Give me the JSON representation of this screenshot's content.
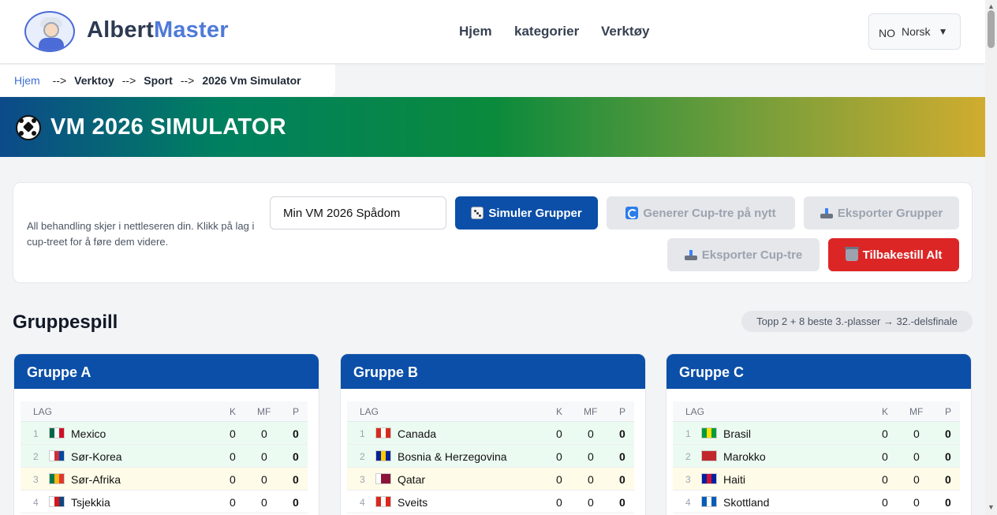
{
  "header": {
    "logo_part1": "Albert",
    "logo_part2": "Master",
    "nav": [
      "Hjem",
      "kategorier",
      "Verktøy"
    ],
    "language": {
      "code": "NO",
      "label": "Norsk",
      "caret": "▼"
    }
  },
  "breadcrumb": {
    "separator": "-->",
    "items": [
      "Hjem",
      "Verktoy",
      "Sport",
      "2026 Vm Simulator"
    ]
  },
  "banner": {
    "title": "VM 2026 SIMULATOR"
  },
  "controls": {
    "info": "All behandling skjer i nettleseren din. Klikk på lag i cup-treet for å føre dem videre.",
    "name_value": "Min VM 2026 Spådom",
    "buttons": {
      "simulate": "Simuler Grupper",
      "regenerate": "Generer Cup-tre på nytt",
      "export_groups": "Eksporter Grupper",
      "export_cup": "Eksporter Cup-tre",
      "reset": "Tilbakestill Alt"
    }
  },
  "groupstage": {
    "title": "Gruppespill",
    "note": "Topp 2 + 8 beste 3.-plasser → 32.-delsfinale",
    "columns": {
      "team": "LAG",
      "k": "K",
      "mf": "MF",
      "p": "P"
    },
    "groups": [
      {
        "name": "Gruppe A",
        "teams": [
          {
            "rank": "1",
            "name": "Mexico",
            "k": "0",
            "mf": "0",
            "p": "0",
            "flag": [
              "#006847",
              "#ffffff",
              "#ce1126"
            ]
          },
          {
            "rank": "2",
            "name": "Sør-Korea",
            "k": "0",
            "mf": "0",
            "p": "0",
            "flag": [
              "#ffffff",
              "#cd2e3a",
              "#0047a0"
            ]
          },
          {
            "rank": "3",
            "name": "Sør-Afrika",
            "k": "0",
            "mf": "0",
            "p": "0",
            "flag": [
              "#007a4d",
              "#ffb612",
              "#de3831"
            ]
          },
          {
            "rank": "4",
            "name": "Tsjekkia",
            "k": "0",
            "mf": "0",
            "p": "0",
            "flag": [
              "#ffffff",
              "#d7141a",
              "#11457e"
            ]
          }
        ]
      },
      {
        "name": "Gruppe B",
        "teams": [
          {
            "rank": "1",
            "name": "Canada",
            "k": "0",
            "mf": "0",
            "p": "0",
            "flag": [
              "#d52b1e",
              "#ffffff",
              "#d52b1e"
            ]
          },
          {
            "rank": "2",
            "name": "Bosnia & Herzegovina",
            "k": "0",
            "mf": "0",
            "p": "0",
            "flag": [
              "#002395",
              "#fecb00",
              "#002395"
            ]
          },
          {
            "rank": "3",
            "name": "Qatar",
            "k": "0",
            "mf": "0",
            "p": "0",
            "flag": [
              "#ffffff",
              "#8a1538",
              "#8a1538"
            ]
          },
          {
            "rank": "4",
            "name": "Sveits",
            "k": "0",
            "mf": "0",
            "p": "0",
            "flag": [
              "#da291c",
              "#ffffff",
              "#da291c"
            ]
          }
        ]
      },
      {
        "name": "Gruppe C",
        "teams": [
          {
            "rank": "1",
            "name": "Brasil",
            "k": "0",
            "mf": "0",
            "p": "0",
            "flag": [
              "#009c3b",
              "#ffdf00",
              "#009c3b"
            ]
          },
          {
            "rank": "2",
            "name": "Marokko",
            "k": "0",
            "mf": "0",
            "p": "0",
            "flag": [
              "#c1272d",
              "#c1272d",
              "#c1272d"
            ]
          },
          {
            "rank": "3",
            "name": "Haiti",
            "k": "0",
            "mf": "0",
            "p": "0",
            "flag": [
              "#00209f",
              "#d21034",
              "#00209f"
            ]
          },
          {
            "rank": "4",
            "name": "Skottland",
            "k": "0",
            "mf": "0",
            "p": "0",
            "flag": [
              "#005eb8",
              "#ffffff",
              "#005eb8"
            ]
          }
        ]
      }
    ]
  },
  "colors": {
    "primary": "#0b4fa8",
    "danger": "#dc2626",
    "qualified_row": "#ecfbf1",
    "third_row": "#fefbe8"
  }
}
